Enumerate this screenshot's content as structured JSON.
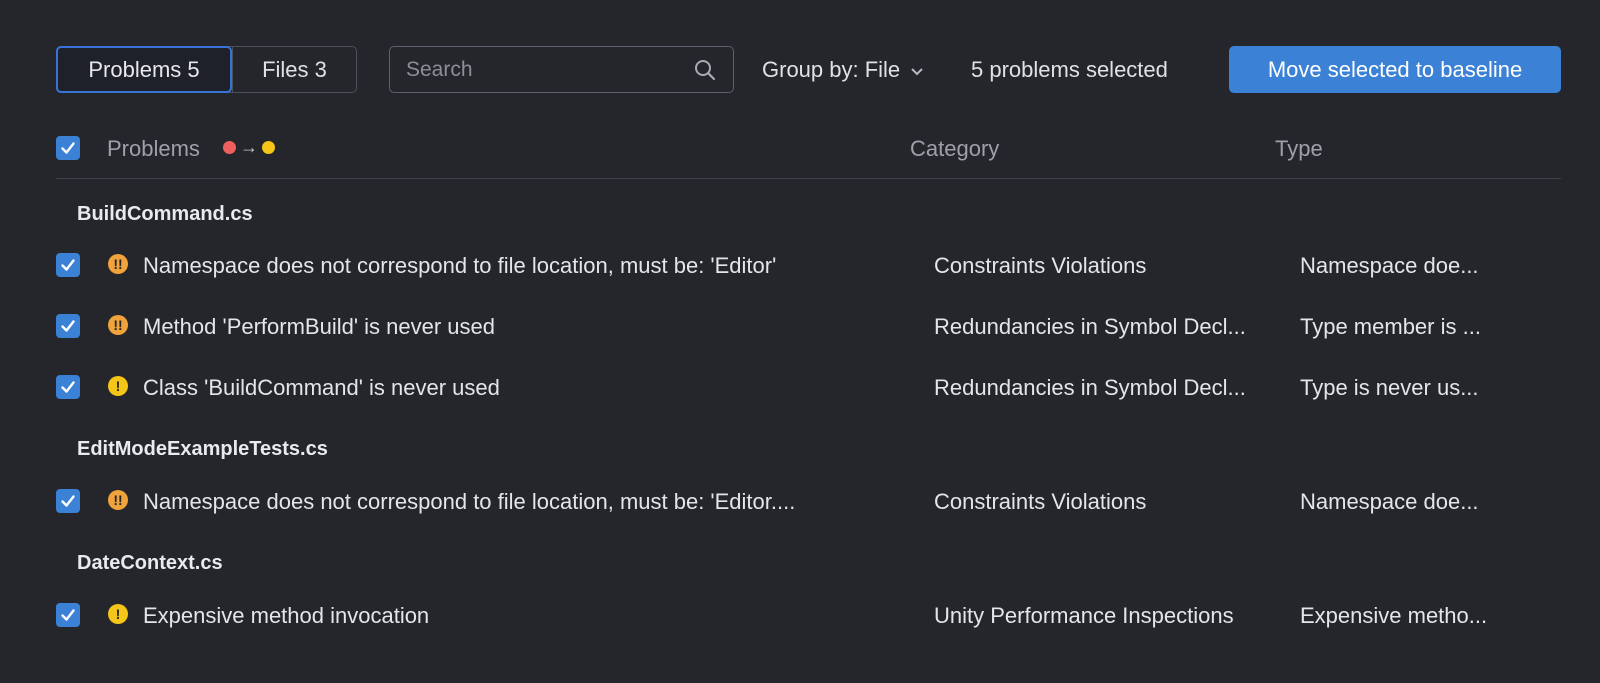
{
  "toolbar": {
    "tabs": [
      {
        "label": "Problems 5",
        "active": true
      },
      {
        "label": "Files 3",
        "active": false
      }
    ],
    "search_placeholder": "Search",
    "group_by_label": "Group by: File",
    "selected_count": "5 problems selected",
    "move_button_label": "Move selected to baseline"
  },
  "header": {
    "problems_label": "Problems",
    "category_label": "Category",
    "type_label": "Type",
    "severity_arrow": "→"
  },
  "colors": {
    "accent": "#3b82d6",
    "error_dot": "#ef5f5f",
    "warning_dot": "#f5c518",
    "orange_severity": "#f0a33a",
    "yellow_severity": "#f5c518"
  },
  "groups": [
    {
      "file": "BuildCommand.cs",
      "rows": [
        {
          "severity": "orange",
          "icon": "!!",
          "problem": "Namespace does not correspond to file location, must be: 'Editor'",
          "category": "Constraints Violations",
          "type": "Namespace doe..."
        },
        {
          "severity": "orange",
          "icon": "!!",
          "problem": "Method 'PerformBuild' is never used",
          "category": "Redundancies in Symbol Decl...",
          "type": "Type member is ..."
        },
        {
          "severity": "yellow",
          "icon": "!",
          "problem": "Class 'BuildCommand' is never used",
          "category": "Redundancies in Symbol Decl...",
          "type": "Type is never us..."
        }
      ]
    },
    {
      "file": "EditModeExampleTests.cs",
      "rows": [
        {
          "severity": "orange",
          "icon": "!!",
          "problem": "Namespace does not correspond to file location, must be: 'Editor....",
          "category": "Constraints Violations",
          "type": "Namespace doe..."
        }
      ]
    },
    {
      "file": "DateContext.cs",
      "rows": [
        {
          "severity": "yellow",
          "icon": "!",
          "problem": "Expensive method invocation",
          "category": "Unity Performance Inspections",
          "type": "Expensive metho..."
        }
      ]
    }
  ]
}
